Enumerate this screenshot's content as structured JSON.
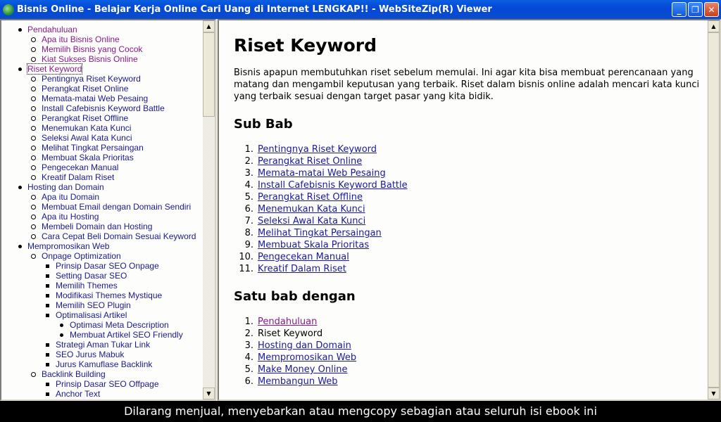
{
  "window": {
    "title": "Bisnis Online - Belajar Kerja Online Cari Uang di Internet LENGKAP!! - WebSiteZip(R) Viewer"
  },
  "toc": [
    {
      "label": "Pendahuluan",
      "visited": true,
      "children": [
        {
          "label": "Apa itu Bisnis Online",
          "visited": true
        },
        {
          "label": "Memilih Bisnis yang Cocok",
          "visited": true
        },
        {
          "label": "Kiat Sukses Bisnis Online",
          "visited": true
        }
      ]
    },
    {
      "label": "Riset Keyword",
      "visited": true,
      "focused": true,
      "children": [
        {
          "label": "Pentingnya Riset Keyword"
        },
        {
          "label": "Perangkat Riset Online"
        },
        {
          "label": "Memata-matai Web Pesaing"
        },
        {
          "label": "Install Cafebisnis Keyword Battle"
        },
        {
          "label": "Perangkat Riset Offline"
        },
        {
          "label": "Menemukan Kata Kunci"
        },
        {
          "label": "Seleksi Awal Kata Kunci"
        },
        {
          "label": "Melihat Tingkat Persaingan"
        },
        {
          "label": "Membuat Skala Prioritas"
        },
        {
          "label": "Pengecekan Manual"
        },
        {
          "label": "Kreatif Dalam Riset"
        }
      ]
    },
    {
      "label": "Hosting dan Domain",
      "children": [
        {
          "label": "Apa itu Domain"
        },
        {
          "label": "Membuat Email dengan Domain Sendiri"
        },
        {
          "label": "Apa itu Hosting"
        },
        {
          "label": "Membeli Domain dan Hosting"
        },
        {
          "label": "Cara Cepat Beli Domain Sesuai Keyword"
        }
      ]
    },
    {
      "label": "Mempromosikan Web",
      "children": [
        {
          "label": "Onpage Optimization",
          "children": [
            {
              "label": "Prinsip Dasar SEO Onpage"
            },
            {
              "label": "Setting Dasar SEO"
            },
            {
              "label": "Memilih Themes"
            },
            {
              "label": "Modifikasi Themes Mystique"
            },
            {
              "label": "Memilih SEO Plugin"
            },
            {
              "label": "Optimalisasi Artikel",
              "children": [
                {
                  "label": "Optimasi Meta Description"
                },
                {
                  "label": "Membuat Artikel SEO Friendly"
                }
              ]
            },
            {
              "label": "Strategi Aman Tukar Link"
            },
            {
              "label": "SEO Jurus Mabuk"
            },
            {
              "label": "Jurus Kamuflase Backlink"
            }
          ]
        },
        {
          "label": "Backlink Building",
          "children": [
            {
              "label": "Prinsip Dasar SEO Offpage"
            },
            {
              "label": "Anchor Text"
            }
          ]
        }
      ]
    }
  ],
  "main": {
    "title": "Riset Keyword",
    "intro": "Bisnis apapun membutuhkan riset sebelum memulai. Ini agar kita bisa membuat perencanaan yang matang dan mengambil keputusan yang terbaik. Riset dalam bisnis online adalah mencari kata kunci yang terbaik sesuai dengan target pasar yang kita bidik.",
    "subbab_heading": "Sub Bab",
    "subbab": [
      {
        "label": "Pentingnya Riset Keyword",
        "link": true
      },
      {
        "label": "Perangkat Riset Online",
        "link": true
      },
      {
        "label": "Memata-matai Web Pesaing",
        "link": true
      },
      {
        "label": "Install Cafebisnis Keyword Battle",
        "link": true
      },
      {
        "label": "Perangkat Riset Offline",
        "link": true
      },
      {
        "label": "Menemukan Kata Kunci",
        "link": true
      },
      {
        "label": "Seleksi Awal Kata Kunci",
        "link": true
      },
      {
        "label": "Melihat Tingkat Persaingan",
        "link": true
      },
      {
        "label": "Membuat Skala Prioritas",
        "link": true
      },
      {
        "label": "Pengecekan Manual",
        "link": true
      },
      {
        "label": "Kreatif Dalam Riset",
        "link": true
      }
    ],
    "satubab_heading": "Satu bab dengan",
    "satubab": [
      {
        "label": "Pendahuluan",
        "link": true,
        "visited": true
      },
      {
        "label": "Riset Keyword",
        "link": false
      },
      {
        "label": "Hosting dan Domain",
        "link": true
      },
      {
        "label": "Mempromosikan Web",
        "link": true
      },
      {
        "label": "Make Money Online",
        "link": true
      },
      {
        "label": "Membangun Web",
        "link": true
      }
    ]
  },
  "footer": {
    "text": "Dilarang menjual, menyebarkan atau mengcopy sebagian atau seluruh isi ebook ini"
  },
  "colors": {
    "visited_link": "#8a1a8a",
    "link": "#1a1a9c",
    "titlebar": "#0348d8",
    "footer_bg": "#000000"
  }
}
